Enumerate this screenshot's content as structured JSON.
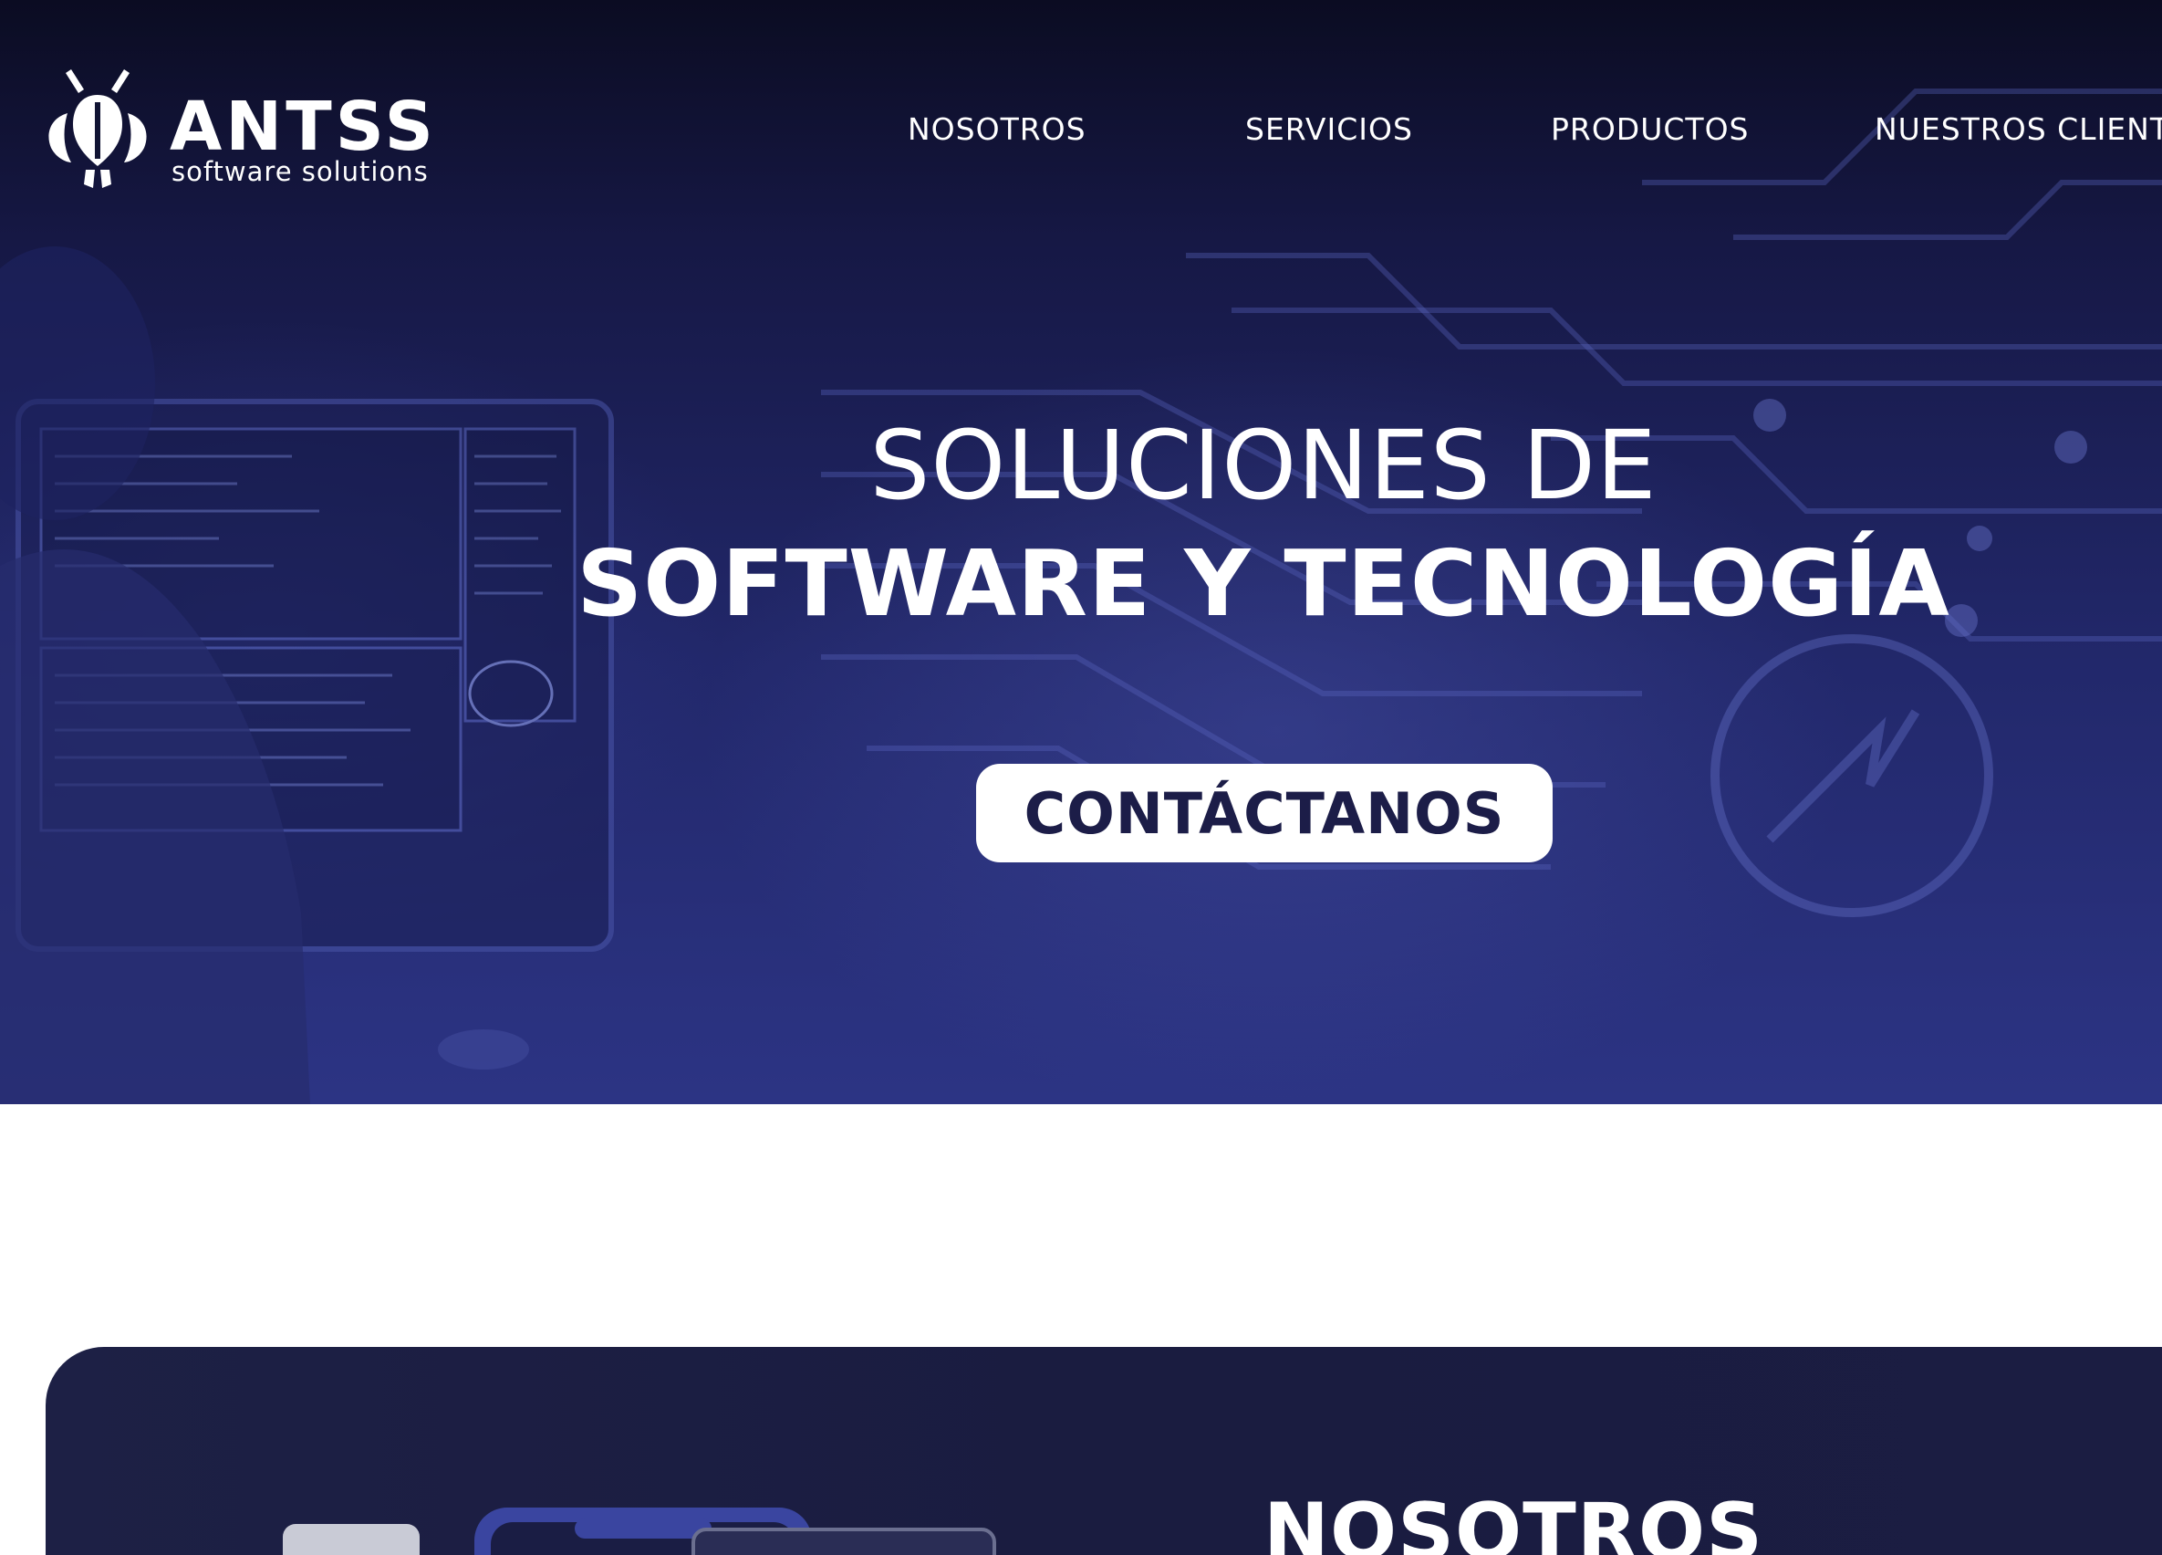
{
  "brand": {
    "name": "ANTSS",
    "tagline": "software solutions",
    "logo_icon": "ant-icon"
  },
  "nav": {
    "items": [
      {
        "label": "NOSOTROS"
      },
      {
        "label": "SERVICIOS"
      },
      {
        "label": "PRODUCTOS"
      },
      {
        "label": "NUESTROS CLIENT"
      }
    ]
  },
  "hero": {
    "headline_line1": "SOLUCIONES DE",
    "headline_line2": "SOFTWARE Y TECNOLOGÍA",
    "cta_label": "CONTÁCTANOS",
    "background_image": "developer-at-monitor-with-circuit-overlay"
  },
  "about": {
    "title": "NOSOTROS"
  },
  "colors": {
    "hero_dark": "#0b0c22",
    "hero_blue": "#2c3484",
    "cta_text": "#1c1d48",
    "section_bg": "#1a1c40"
  }
}
